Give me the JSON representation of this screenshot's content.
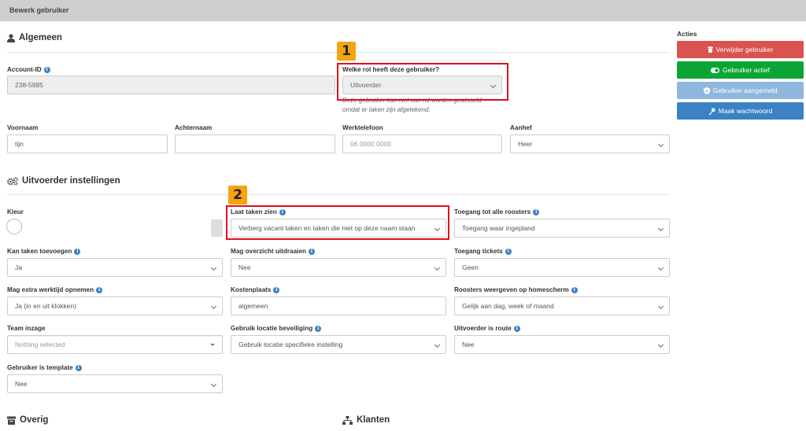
{
  "header": {
    "title": "Bewerk gebruiker"
  },
  "general": {
    "title": "Algemeen",
    "account_id_label": "Account-ID",
    "account_id_value": "238-5985",
    "role_label": "Welke rol heeft deze gebruiker?",
    "role_value": "Uitvoerder",
    "role_note_line1": "Deze gebruiker kan niet van rol worden gewisseld",
    "role_note_line2": "omdat er taken zijn afgetekend.",
    "firstname_label": "Voornaam",
    "firstname_value": "tijn",
    "lastname_label": "Achternaam",
    "lastname_value": "",
    "phone_label": "Werktelefoon",
    "phone_placeholder": "06 0000 0000",
    "salutation_label": "Aanhef",
    "salutation_value": "Heer"
  },
  "executor": {
    "title": "Uitvoerder instellingen",
    "color_label": "Kleur",
    "show_tasks_label": "Laat taken zien",
    "show_tasks_value": "Verberg vacant taken en taken die niet op deze naam staan",
    "all_schedules_label": "Toegang tot alle roosters",
    "all_schedules_value": "Toegang waar ingepland",
    "add_tasks_label": "Kan taken toevoegen",
    "add_tasks_value": "Ja",
    "print_overview_label": "Mag overzicht uitdraaien",
    "print_overview_value": "Nee",
    "tickets_label": "Toegang tickets",
    "tickets_value": "Geen",
    "extra_time_label": "Mag extra werktijd opnemen",
    "extra_time_value": "Ja (in en uit klokken)",
    "cost_center_label": "Kostenplaats",
    "cost_center_value": "algemeen",
    "home_schedules_label": "Roosters weergeven op homescherm",
    "home_schedules_value": "Gelijk aan dag, week of maand",
    "team_label": "Team inzage",
    "team_placeholder": "Nothing selected",
    "location_security_label": "Gebruik locatie beveiliging",
    "location_security_value": "Gebruik locatie specifieke instelling",
    "route_label": "Uitvoerder is route",
    "route_value": "Nee",
    "template_label": "Gebruiker is template",
    "template_value": "Nee"
  },
  "other": {
    "title": "Overig"
  },
  "clients": {
    "title": "Klanten"
  },
  "actions": {
    "title": "Acties",
    "delete_label": "Verwijder gebruiker",
    "active_label": "Gebruiker actief",
    "signed_in_label": "Gebruiker aangemeld",
    "password_label": "Maak wachtwoord"
  },
  "callouts": {
    "one": "1",
    "two": "2"
  },
  "colors": {
    "delete": "#d9534f",
    "active": "#0ca535",
    "signed_in": "#8fb7de",
    "password": "#3a82c4",
    "highlight": "#e10e1c",
    "badge": "#f5a30f"
  }
}
